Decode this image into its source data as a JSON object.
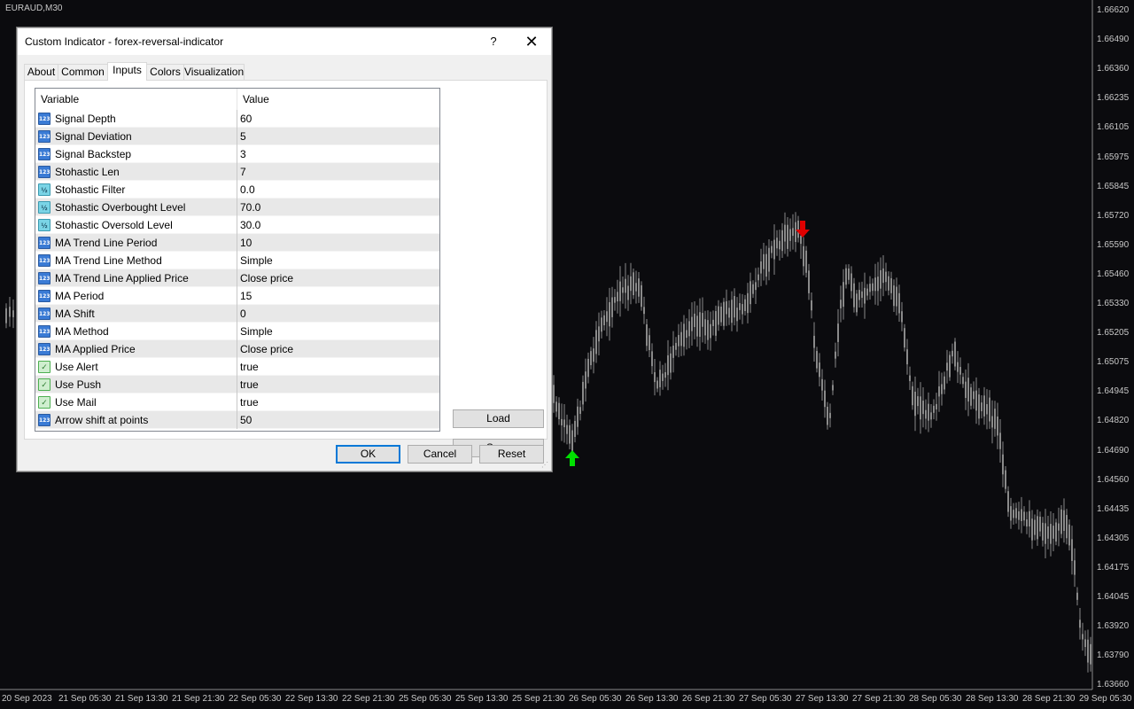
{
  "chart": {
    "symbol": "EURAUD,M30",
    "price_labels": [
      "1.66620",
      "1.66490",
      "1.66360",
      "1.66235",
      "1.66105",
      "1.65975",
      "1.65845",
      "1.65720",
      "1.65590",
      "1.65460",
      "1.65330",
      "1.65205",
      "1.65075",
      "1.64945",
      "1.64820",
      "1.64690",
      "1.64560",
      "1.64435",
      "1.64305",
      "1.64175",
      "1.64045",
      "1.63920",
      "1.63790",
      "1.63660"
    ],
    "time_labels": [
      "20 Sep 2023",
      "21 Sep 05:30",
      "21 Sep 13:30",
      "21 Sep 21:30",
      "22 Sep 05:30",
      "22 Sep 13:30",
      "22 Sep 21:30",
      "25 Sep 05:30",
      "25 Sep 13:30",
      "25 Sep 21:30",
      "26 Sep 05:30",
      "26 Sep 13:30",
      "26 Sep 21:30",
      "27 Sep 05:30",
      "27 Sep 13:30",
      "27 Sep 21:30",
      "28 Sep 05:30",
      "28 Sep 13:30",
      "28 Sep 21:30",
      "29 Sep 05:30"
    ],
    "colors": {
      "background": "#0b0b0e",
      "candle": "#8a8a8a",
      "buy_arrow": "#00e000",
      "sell_arrow": "#e00000",
      "axis_text": "#c8c8c8"
    },
    "signals": {
      "buy_arrow": "up-arrow-icon",
      "sell_arrow": "down-arrow-icon"
    }
  },
  "dialog": {
    "title": "Custom Indicator - forex-reversal-indicator",
    "help_label": "?",
    "close_label": "✕",
    "tabs": [
      {
        "label": "About"
      },
      {
        "label": "Common"
      },
      {
        "label": "Inputs",
        "active": true
      },
      {
        "label": "Colors"
      },
      {
        "label": "Visualization"
      }
    ],
    "table": {
      "col_variable": "Variable",
      "col_value": "Value",
      "rows": [
        {
          "type": "int",
          "icon_text": "123",
          "variable": "Signal Depth",
          "value": "60"
        },
        {
          "type": "int",
          "icon_text": "123",
          "variable": "Signal Deviation",
          "value": "5"
        },
        {
          "type": "int",
          "icon_text": "123",
          "variable": "Signal Backstep",
          "value": "3"
        },
        {
          "type": "int",
          "icon_text": "123",
          "variable": "Stohastic Len",
          "value": "7"
        },
        {
          "type": "double",
          "icon_text": "½",
          "variable": "Stohastic Filter",
          "value": "0.0"
        },
        {
          "type": "double",
          "icon_text": "½",
          "variable": "Stohastic Overbought Level",
          "value": "70.0"
        },
        {
          "type": "double",
          "icon_text": "½",
          "variable": "Stohastic Oversold Level",
          "value": "30.0"
        },
        {
          "type": "int",
          "icon_text": "123",
          "variable": "MA Trend Line Period",
          "value": "10"
        },
        {
          "type": "int",
          "icon_text": "123",
          "variable": "MA Trend Line Method",
          "value": "Simple"
        },
        {
          "type": "int",
          "icon_text": "123",
          "variable": "MA Trend Line Applied Price",
          "value": "Close price"
        },
        {
          "type": "int",
          "icon_text": "123",
          "variable": "MA Period",
          "value": "15"
        },
        {
          "type": "int",
          "icon_text": "123",
          "variable": "MA Shift",
          "value": "0"
        },
        {
          "type": "int",
          "icon_text": "123",
          "variable": "MA Method",
          "value": "Simple"
        },
        {
          "type": "int",
          "icon_text": "123",
          "variable": "MA Applied Price",
          "value": "Close price"
        },
        {
          "type": "bool",
          "icon_text": "✓",
          "variable": "Use Alert",
          "value": "true"
        },
        {
          "type": "bool",
          "icon_text": "✓",
          "variable": "Use Push",
          "value": "true"
        },
        {
          "type": "bool",
          "icon_text": "✓",
          "variable": "Use Mail",
          "value": "true"
        },
        {
          "type": "int",
          "icon_text": "123",
          "variable": "Arrow shift at points",
          "value": "50"
        }
      ]
    },
    "buttons": {
      "load": "Load",
      "save": "Save",
      "ok": "OK",
      "cancel": "Cancel",
      "reset": "Reset"
    }
  }
}
